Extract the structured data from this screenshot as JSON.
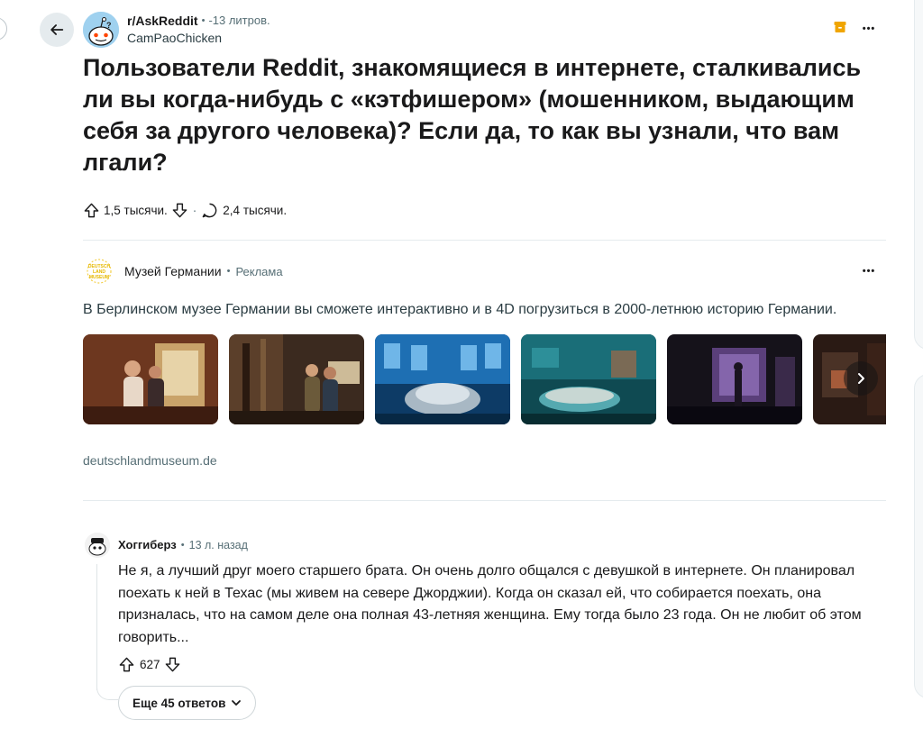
{
  "post": {
    "subreddit": "r/AskReddit",
    "time": "-13 литров.",
    "author": "CamPaoChicken",
    "title": "Пользователи Reddit, знакомящиеся в интернете, сталкивались ли вы когда-нибудь с «кэтфишером» (мошенником, выдающим себя за другого человека)? Если да, то как вы узнали, что вам лгали?",
    "upvotes": "1,5 тысячи.",
    "comments": "2,4 тысячи.",
    "separator": "·"
  },
  "ad": {
    "advertiser": "Музей Германии",
    "label": "Реклама",
    "text": "В Берлинском музее Германии вы сможете интерактивно и в 4D погрузиться в 2000-летнюю историю Германии.",
    "domain": "deutschlandmuseum.de",
    "logo_text": "DEUTSCHLAND MUSEUM"
  },
  "comment": {
    "author": "Хоггиберз",
    "time": "13 л. назад",
    "body": "Не я, а лучший друг моего старшего брата. Он очень долго общался с девушкой в интернете. Он планировал поехать к ней в Техас (мы живем на севере Джорджии). Когда он сказал ей, что собирается поехать, она призналась, что на самом деле она полная 43-летняя женщина. Ему тогда было 23 года. Он не любит об этом говорить...",
    "score": "627",
    "more_replies": "Еще 45 ответов"
  },
  "bullet": "•",
  "more_glyph": "•••",
  "colors": {
    "accent_archive": "#f0a500",
    "muted_text": "#576f76",
    "divider": "#e5ebee"
  },
  "icons": [
    "back-arrow-icon",
    "archive-icon",
    "more-options-icon",
    "upvote-icon",
    "downvote-icon",
    "comment-icon",
    "chevron-right-icon",
    "chevron-down-icon"
  ]
}
